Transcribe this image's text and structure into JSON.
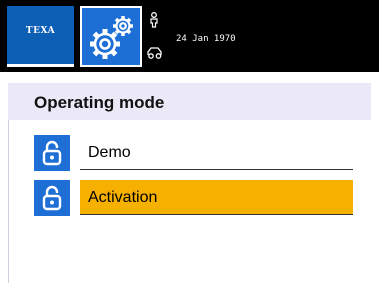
{
  "header": {
    "logo_text": "TEXA",
    "date": "24 Jan 1970"
  },
  "panel": {
    "title": "Operating mode",
    "items": [
      {
        "label": "Demo",
        "icon": "unlocked-padlock-icon",
        "selected": false
      },
      {
        "label": "Activation",
        "icon": "unlocked-padlock-icon",
        "selected": true
      }
    ]
  },
  "colors": {
    "topbar": "#000000",
    "logo_tile": "#0c5fb4",
    "icon_tile": "#1d6fd6",
    "panel_bg": "#ebe9f8",
    "selection": "#f5b000"
  }
}
